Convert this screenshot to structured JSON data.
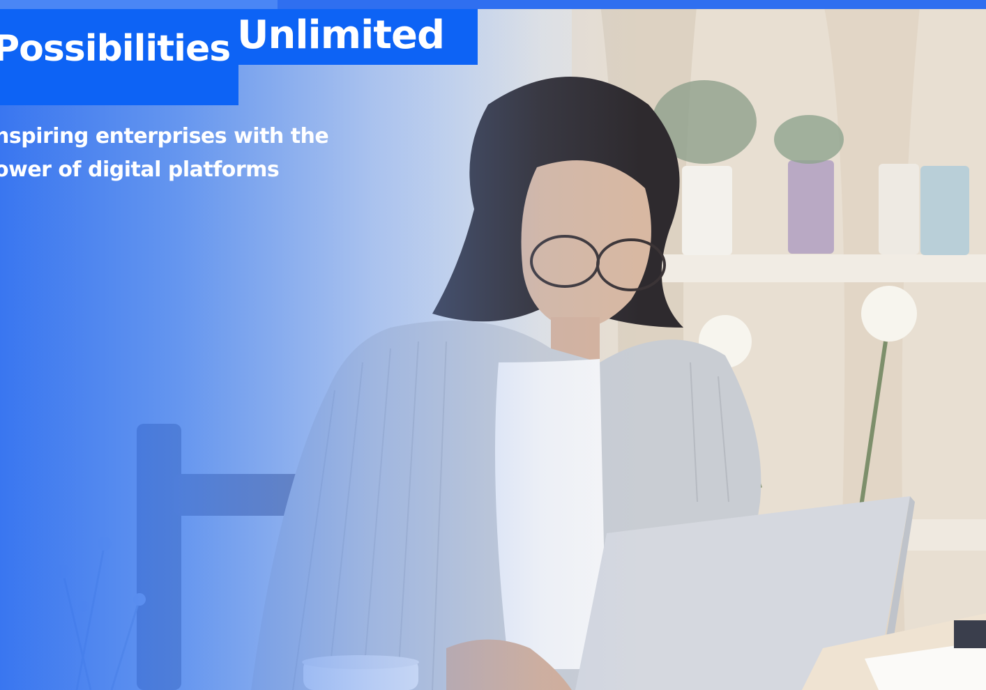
{
  "hero": {
    "headline_word_1": "Possibilities",
    "headline_word_2": "Unlimited",
    "subtitle_line_1": "nspiring enterprises with the",
    "subtitle_line_2": "ower of digital platforms"
  },
  "image": {
    "subject": "woman-working-on-laptop-photo"
  },
  "colors": {
    "accent_blue": "#0d63f5",
    "top_strip": "#2f6ff0",
    "text_on_accent": "#ffffff"
  }
}
